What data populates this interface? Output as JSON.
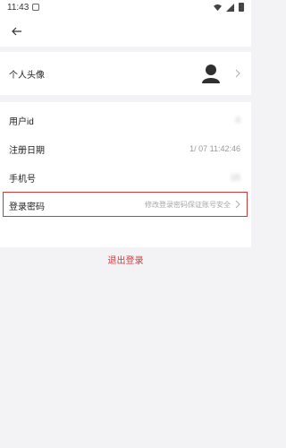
{
  "status_bar": {
    "time": "11:43"
  },
  "avatar_row": {
    "label": "个人头像"
  },
  "rows": [
    {
      "label": "用户id",
      "value": "4"
    },
    {
      "label": "注册日期",
      "value": "1/      07 11:42:46"
    },
    {
      "label": "手机号",
      "value": "15"
    }
  ],
  "password_row": {
    "label": "登录密码",
    "hint": "修改登录密码保证账号安全"
  },
  "logout": {
    "label": "退出登录"
  }
}
